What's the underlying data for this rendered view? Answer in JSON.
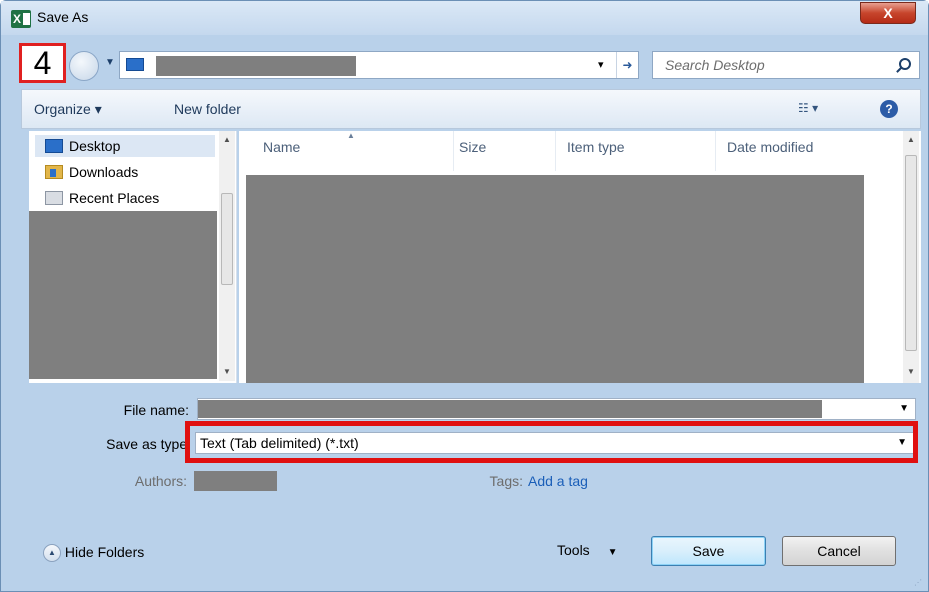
{
  "window": {
    "title": "Save As",
    "close_label": "X",
    "app_icon": "excel-icon"
  },
  "step_badge": "4",
  "address": {
    "dropdown_glyph": "▾",
    "refresh_glyph": "⁴⁺",
    "search_placeholder": "Search Desktop"
  },
  "toolbar": {
    "organize_label": "Organize ▾",
    "new_folder_label": "New folder",
    "views_glyph": "☷ ▾",
    "help_glyph": "?"
  },
  "nav": {
    "items": [
      {
        "label": "Desktop",
        "icon": "desktop-icon"
      },
      {
        "label": "Downloads",
        "icon": "downloads-icon"
      },
      {
        "label": "Recent Places",
        "icon": "recent-places-icon"
      }
    ]
  },
  "filelist": {
    "columns": [
      "Name",
      "Size",
      "Item type",
      "Date modified"
    ]
  },
  "form": {
    "file_name_label": "File name:",
    "save_type_label": "Save as type:",
    "save_type_value": "Text (Tab delimited) (*.txt)",
    "authors_label": "Authors:",
    "tags_label": "Tags:",
    "tags_link": "Add a tag"
  },
  "footer": {
    "hide_folders_label": "Hide Folders",
    "tools_label": "Tools",
    "save_label": "Save",
    "cancel_label": "Cancel"
  },
  "colors": {
    "highlight": "#e01010",
    "window_frame": "#b9d1ea",
    "redaction": "#7f7f7f"
  }
}
